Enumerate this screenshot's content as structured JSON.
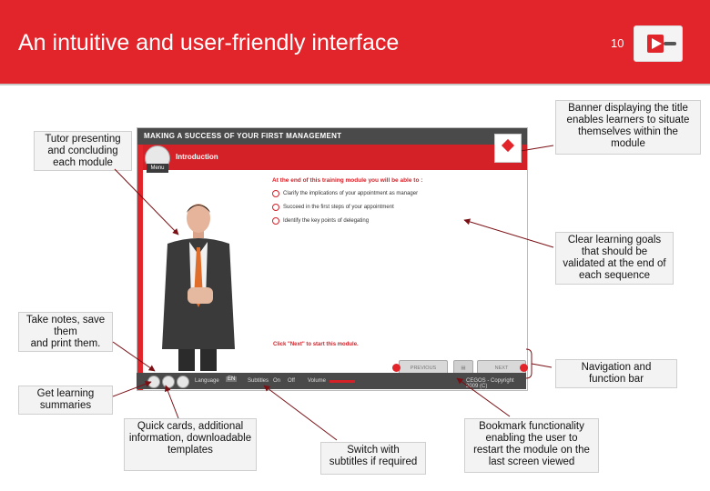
{
  "slide": {
    "title": "An intuitive and user-friendly interface",
    "number": "10"
  },
  "module": {
    "header_title": "MAKING A SUCCESS OF YOUR FIRST MANAGEMENT",
    "menu_label": "Menu",
    "section_title": "Introduction",
    "objectives_title": "At the end of this training module you will be able to :",
    "objectives": [
      "Clarify the implications of your appointment as manager",
      "Succeed in the first steps of your appointment",
      "Identify the key points of delegating"
    ],
    "click_next": "Click \"Next\" to start this module.",
    "nav": {
      "previous": "PREVIOUS",
      "next": "NEXT"
    }
  },
  "function_bar": {
    "language_label": "Language",
    "language_value": "EN",
    "subtitles_label": "Subtitles",
    "subtitles_on": "On",
    "subtitles_off": "Off",
    "volume_label": "Volume",
    "status": "CEGOS - Copyright 2009 (C)"
  },
  "callouts": {
    "tutor": "Tutor presenting\nand concluding\neach module",
    "banner": "Banner displaying the title\nenables learners to situate\nthemselves within the\nmodule",
    "goals": "Clear learning goals\nthat should be\nvalidated at the end of\neach sequence",
    "notes": "Take notes, save\nthem\nand print them.",
    "navigation": "Navigation and\nfunction bar",
    "summaries": "Get learning\nsummaries",
    "quick_cards": "Quick cards, additional\ninformation, downloadable\ntemplates",
    "subtitles": "Switch with\nsubtitles if required",
    "bookmark": "Bookmark functionality\nenabling the user to\nrestart the module on the\nlast screen viewed"
  },
  "colors": {
    "brand_red": "#e2242b",
    "dark_bar": "#4a4a4a",
    "callout_bg": "#f3f3f3"
  }
}
